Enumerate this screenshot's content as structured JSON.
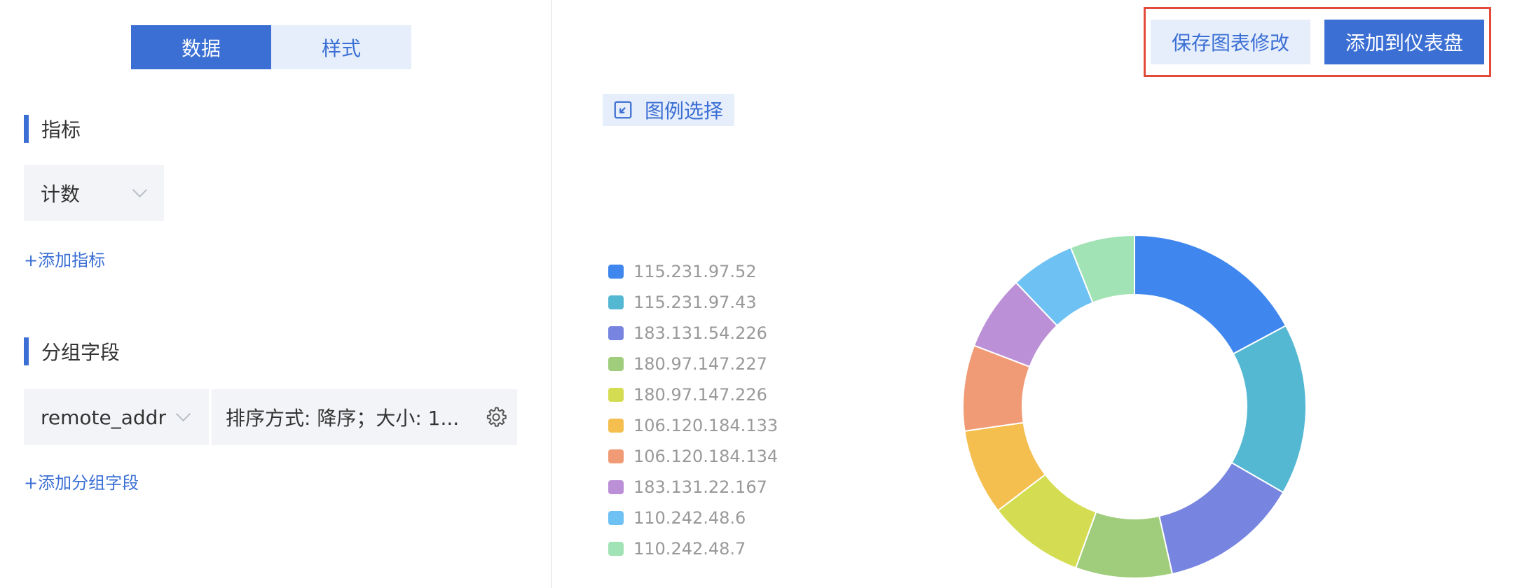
{
  "tabs": {
    "data_label": "数据",
    "style_label": "样式"
  },
  "metrics": {
    "title": "指标",
    "selected": "计数",
    "add_label": "+添加指标"
  },
  "group": {
    "title": "分组字段",
    "field_selected": "remote_addr",
    "sort_summary": "排序方式: 降序；大小: 1...",
    "add_label": "+添加分组字段"
  },
  "actions": {
    "save_label": "保存图表修改",
    "add_dashboard_label": "添加到仪表盘"
  },
  "legend_select_label": "图例选择",
  "chart_data": {
    "type": "pie",
    "donut": true,
    "categories": [
      "115.231.97.52",
      "115.231.97.43",
      "183.131.54.226",
      "180.97.147.227",
      "180.97.147.226",
      "106.120.184.133",
      "106.120.184.134",
      "183.131.22.167",
      "110.242.48.6",
      "110.242.48.7"
    ],
    "values": [
      17,
      16,
      13,
      9,
      9,
      8,
      8,
      7,
      6,
      6
    ],
    "colors": [
      "#3f87ef",
      "#55b8d2",
      "#7785e0",
      "#a0cd7c",
      "#d4dd52",
      "#f4bf4f",
      "#f19b76",
      "#bb90d6",
      "#6ec1f3",
      "#a2e3b5"
    ],
    "legend": "left"
  }
}
